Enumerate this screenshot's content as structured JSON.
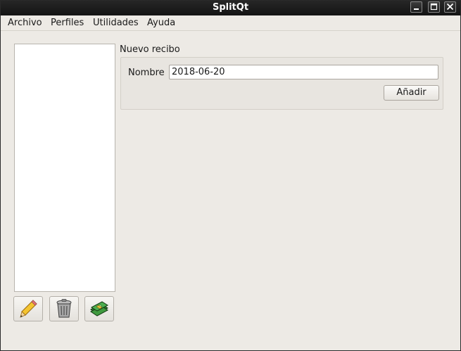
{
  "window": {
    "title": "SplitQt"
  },
  "titlebar_buttons": [
    "minimize",
    "maximize",
    "close"
  ],
  "menu": {
    "items": [
      "Archivo",
      "Perfiles",
      "Utilidades",
      "Ayuda"
    ]
  },
  "receipt_group": {
    "title": "Nuevo recibo",
    "name_label": "Nombre",
    "name_value": "2018-06-20",
    "add_button": "Añadir"
  },
  "toolbar": {
    "icons": [
      "pencil-icon",
      "trash-icon",
      "money-icon"
    ]
  }
}
